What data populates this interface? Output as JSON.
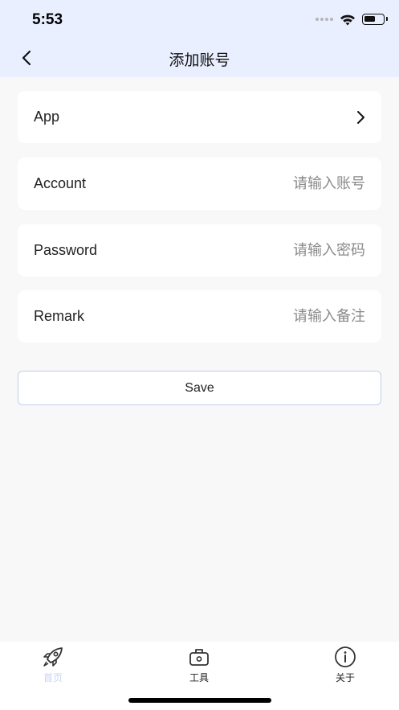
{
  "status_bar": {
    "time": "5:53"
  },
  "nav": {
    "title": "添加账号"
  },
  "form": {
    "app": {
      "label": "App"
    },
    "account": {
      "label": "Account",
      "placeholder": "请输入账号"
    },
    "password": {
      "label": "Password",
      "placeholder": "请输入密码"
    },
    "remark": {
      "label": "Remark",
      "placeholder": "请输入备注"
    }
  },
  "save_label": "Save",
  "tabbar": {
    "tabs": [
      {
        "label": "首页",
        "icon": "rocket-icon",
        "active": true
      },
      {
        "label": "工具",
        "icon": "toolbox-icon",
        "active": false
      },
      {
        "label": "关于",
        "icon": "info-icon",
        "active": false
      }
    ]
  },
  "colors": {
    "header_bg": "#e9efff",
    "page_bg": "#f8f8f8",
    "active_tab": "#c9d3f2",
    "save_border": "#c5cdea"
  }
}
